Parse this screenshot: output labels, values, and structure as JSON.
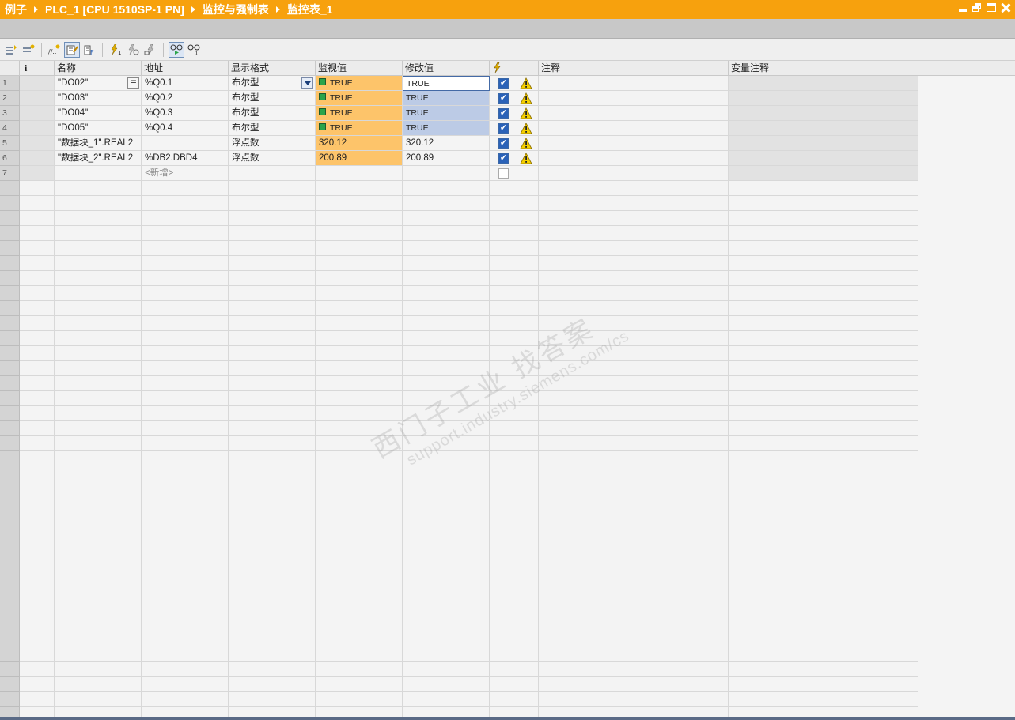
{
  "breadcrumb": [
    "例子",
    "PLC_1 [CPU 1510SP-1 PN]",
    "监控与强制表",
    "监控表_1"
  ],
  "toolbar": {
    "icons": [
      "insert-row-icon",
      "add-row-icon",
      "plc-display-icon",
      "show-all-modify-icon",
      "show-force-icon",
      "modify-now-icon",
      "modify-with-trigger-icon",
      "enable-peripheral-outputs-icon",
      "monitor-all-icon",
      "monitor-once-icon"
    ]
  },
  "columns": {
    "info": "i",
    "name": "名称",
    "address": "地址",
    "format": "显示格式",
    "monitor": "监视值",
    "modify": "修改值",
    "comment": "注释",
    "var_comment": "变量注释"
  },
  "rows": [
    {
      "num": "1",
      "name": "\"DO02\"",
      "address": "%Q0.1",
      "format": "布尔型",
      "monitor": "TRUE",
      "modify": "TRUE",
      "checked": true,
      "warn": true
    },
    {
      "num": "2",
      "name": "\"DO03\"",
      "address": "%Q0.2",
      "format": "布尔型",
      "monitor": "TRUE",
      "modify": "TRUE",
      "checked": true,
      "warn": true
    },
    {
      "num": "3",
      "name": "\"DO04\"",
      "address": "%Q0.3",
      "format": "布尔型",
      "monitor": "TRUE",
      "modify": "TRUE",
      "checked": true,
      "warn": true
    },
    {
      "num": "4",
      "name": "\"DO05\"",
      "address": "%Q0.4",
      "format": "布尔型",
      "monitor": "TRUE",
      "modify": "TRUE",
      "checked": true,
      "warn": true
    },
    {
      "num": "5",
      "name": "\"数据块_1\".REAL2",
      "address": "",
      "format": "浮点数",
      "monitor": "320.12",
      "modify": "320.12",
      "checked": true,
      "warn": true
    },
    {
      "num": "6",
      "name": "\"数据块_2\".REAL2",
      "address": "%DB2.DBD4",
      "format": "浮点数",
      "monitor": "200.89",
      "modify": "200.89",
      "checked": true,
      "warn": true
    }
  ],
  "new_row": {
    "num": "7",
    "placeholder": "<新增>"
  },
  "watermark": {
    "line1": "西门子工业 找答案",
    "line2": "support.industry.siemens.com/cs"
  },
  "colors": {
    "title_bar": "#f7a10d",
    "monitor_value_bg": "#fdc46a",
    "modify_selected_bg": "#bccbe6",
    "bool_true": "#2aa44a"
  }
}
